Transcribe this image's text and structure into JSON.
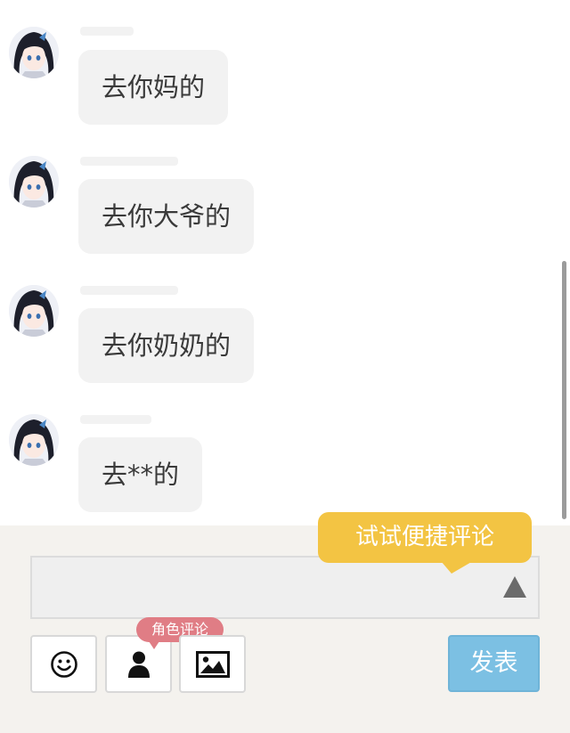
{
  "messages": [
    {
      "text": "去你妈的"
    },
    {
      "text": "去你大爷的"
    },
    {
      "text": "去你奶奶的"
    },
    {
      "text": "去**的"
    }
  ],
  "composer": {
    "input_value": "",
    "tip": "试试便捷评论",
    "role_badge": "角色评论",
    "send_label": "发表"
  },
  "icons": {
    "expand": "triangle-up-icon",
    "emoji": "smiley-icon",
    "role": "person-icon",
    "image": "image-icon"
  },
  "colors": {
    "tip": "#f3c443",
    "role_badge": "#e07d85",
    "send": "#7cc0e3",
    "bubble": "#f2f2f2"
  }
}
